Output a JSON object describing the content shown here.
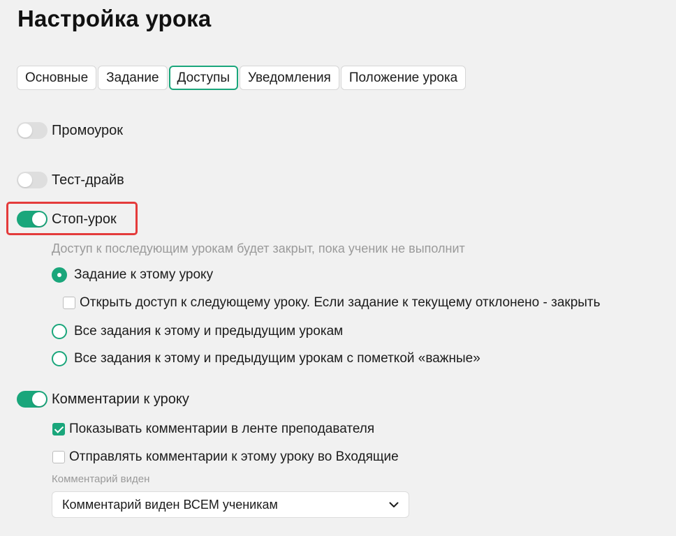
{
  "page_title": "Настройка урока",
  "tabs": [
    {
      "label": "Основные"
    },
    {
      "label": "Задание"
    },
    {
      "label": "Доступы"
    },
    {
      "label": "Уведомления"
    },
    {
      "label": "Положение урока"
    }
  ],
  "active_tab": "Доступы",
  "toggles": {
    "promo": {
      "label": "Промоурок",
      "state": "off"
    },
    "testdrive": {
      "label": "Тест-драйв",
      "state": "off"
    },
    "stop": {
      "label": "Стоп-урок",
      "state": "on"
    },
    "comments": {
      "label": "Комментарии к уроку",
      "state": "on"
    }
  },
  "stop_hint": "Доступ к последующим урокам будет закрыт, пока ученик не выполнит",
  "stop_options": [
    {
      "label": "Задание к этому уроку",
      "selected": true
    },
    {
      "label": "Все задания к этому и предыдущим урокам",
      "selected": false
    },
    {
      "label": "Все задания к этому и предыдущим урокам с пометкой «важные»",
      "selected": false
    }
  ],
  "stop_sub_option": {
    "label": "Открыть доступ к следующему уроку. Если задание к текущему отклонено - закрыть",
    "checked": false
  },
  "comment_options": [
    {
      "label": "Показывать комментарии в ленте преподавателя",
      "checked": true
    },
    {
      "label": "Отправлять комментарии к этому уроку во Входящие",
      "checked": false
    }
  ],
  "visibility": {
    "label": "Комментарий виден",
    "value": "Комментарий виден ВСЕМ ученикам"
  },
  "colors": {
    "accent": "#1aa67b",
    "highlight": "#e43b3b",
    "background": "#f1f1f1"
  },
  "icons": {
    "select_arrow": "chevron-down-icon"
  }
}
